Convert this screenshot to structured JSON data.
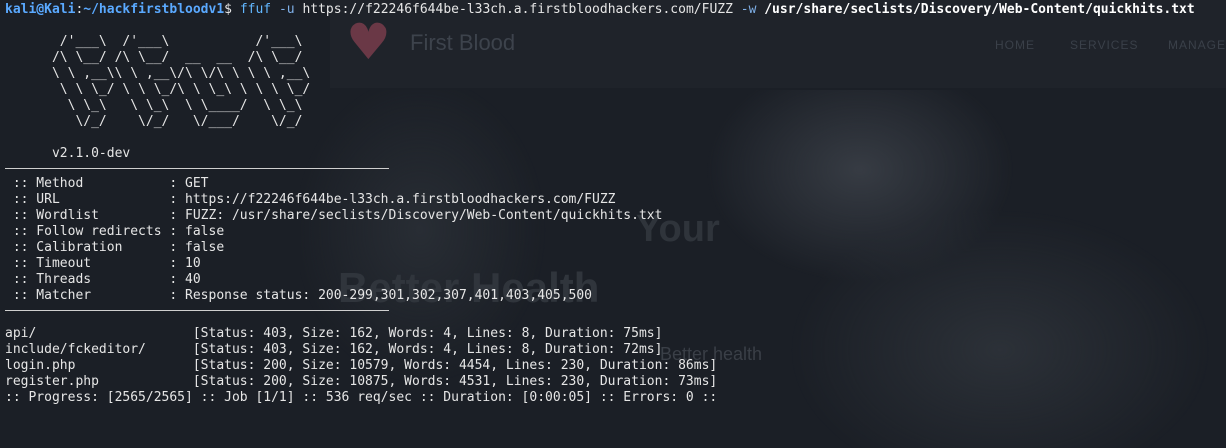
{
  "prompt": {
    "user_host": "kali@Kali",
    "sep": ":",
    "path": "~/hackfirstbloodv1",
    "symbol": "$",
    "command": "ffuf",
    "flag_u": "-u",
    "url": "https://f22246f644be-l33ch.a.firstbloodhackers.com/FUZZ",
    "flag_w": "-w",
    "wordlist": "/usr/share/seclists/Discovery/Web-Content/quickhits.txt"
  },
  "banner": {
    "ascii": [
      "       /'___\\  /'___\\           /'___\\       ",
      "      /\\ \\__/ /\\ \\__/  __  __  /\\ \\__/       ",
      "      \\ \\ ,__\\\\ \\ ,__\\/\\ \\/\\ \\ \\ \\ ,__\\      ",
      "       \\ \\ \\_/ \\ \\ \\_/\\ \\ \\_\\ \\ \\ \\ \\_/      ",
      "        \\ \\_\\   \\ \\_\\  \\ \\____/  \\ \\_\\       ",
      "         \\/_/    \\/_/   \\/___/    \\/_/       "
    ],
    "version": "      v2.1.0-dev"
  },
  "config": [
    {
      "key": " :: Method           : ",
      "value": "GET"
    },
    {
      "key": " :: URL              : ",
      "value": "https://f22246f644be-l33ch.a.firstbloodhackers.com/FUZZ"
    },
    {
      "key": " :: Wordlist         : ",
      "value": "FUZZ: /usr/share/seclists/Discovery/Web-Content/quickhits.txt"
    },
    {
      "key": " :: Follow redirects : ",
      "value": "false"
    },
    {
      "key": " :: Calibration      : ",
      "value": "false"
    },
    {
      "key": " :: Timeout          : ",
      "value": "10"
    },
    {
      "key": " :: Threads          : ",
      "value": "40"
    },
    {
      "key": " :: Matcher          : ",
      "value": "Response status: 200-299,301,302,307,401,403,405,500"
    }
  ],
  "results": [
    {
      "path": "api/                    ",
      "info": "[Status: 403, Size: 162, Words: 4, Lines: 8, Duration: 75ms]"
    },
    {
      "path": "include/fckeditor/      ",
      "info": "[Status: 403, Size: 162, Words: 4, Lines: 8, Duration: 72ms]"
    },
    {
      "path": "login.php               ",
      "info": "[Status: 200, Size: 10579, Words: 4454, Lines: 230, Duration: 86ms]"
    },
    {
      "path": "register.php            ",
      "info": "[Status: 200, Size: 10875, Words: 4531, Lines: 230, Duration: 73ms]"
    }
  ],
  "progress": ":: Progress: [2565/2565] :: Job [1/1] :: 536 req/sec :: Duration: [0:00:05] :: Errors: 0 ::",
  "background": {
    "logo": "First Blood",
    "nav": [
      "HOME",
      "SERVICES",
      "MANAGE"
    ],
    "heading1": "Your",
    "heading2": "Better Health",
    "paragraph": "Better health"
  }
}
